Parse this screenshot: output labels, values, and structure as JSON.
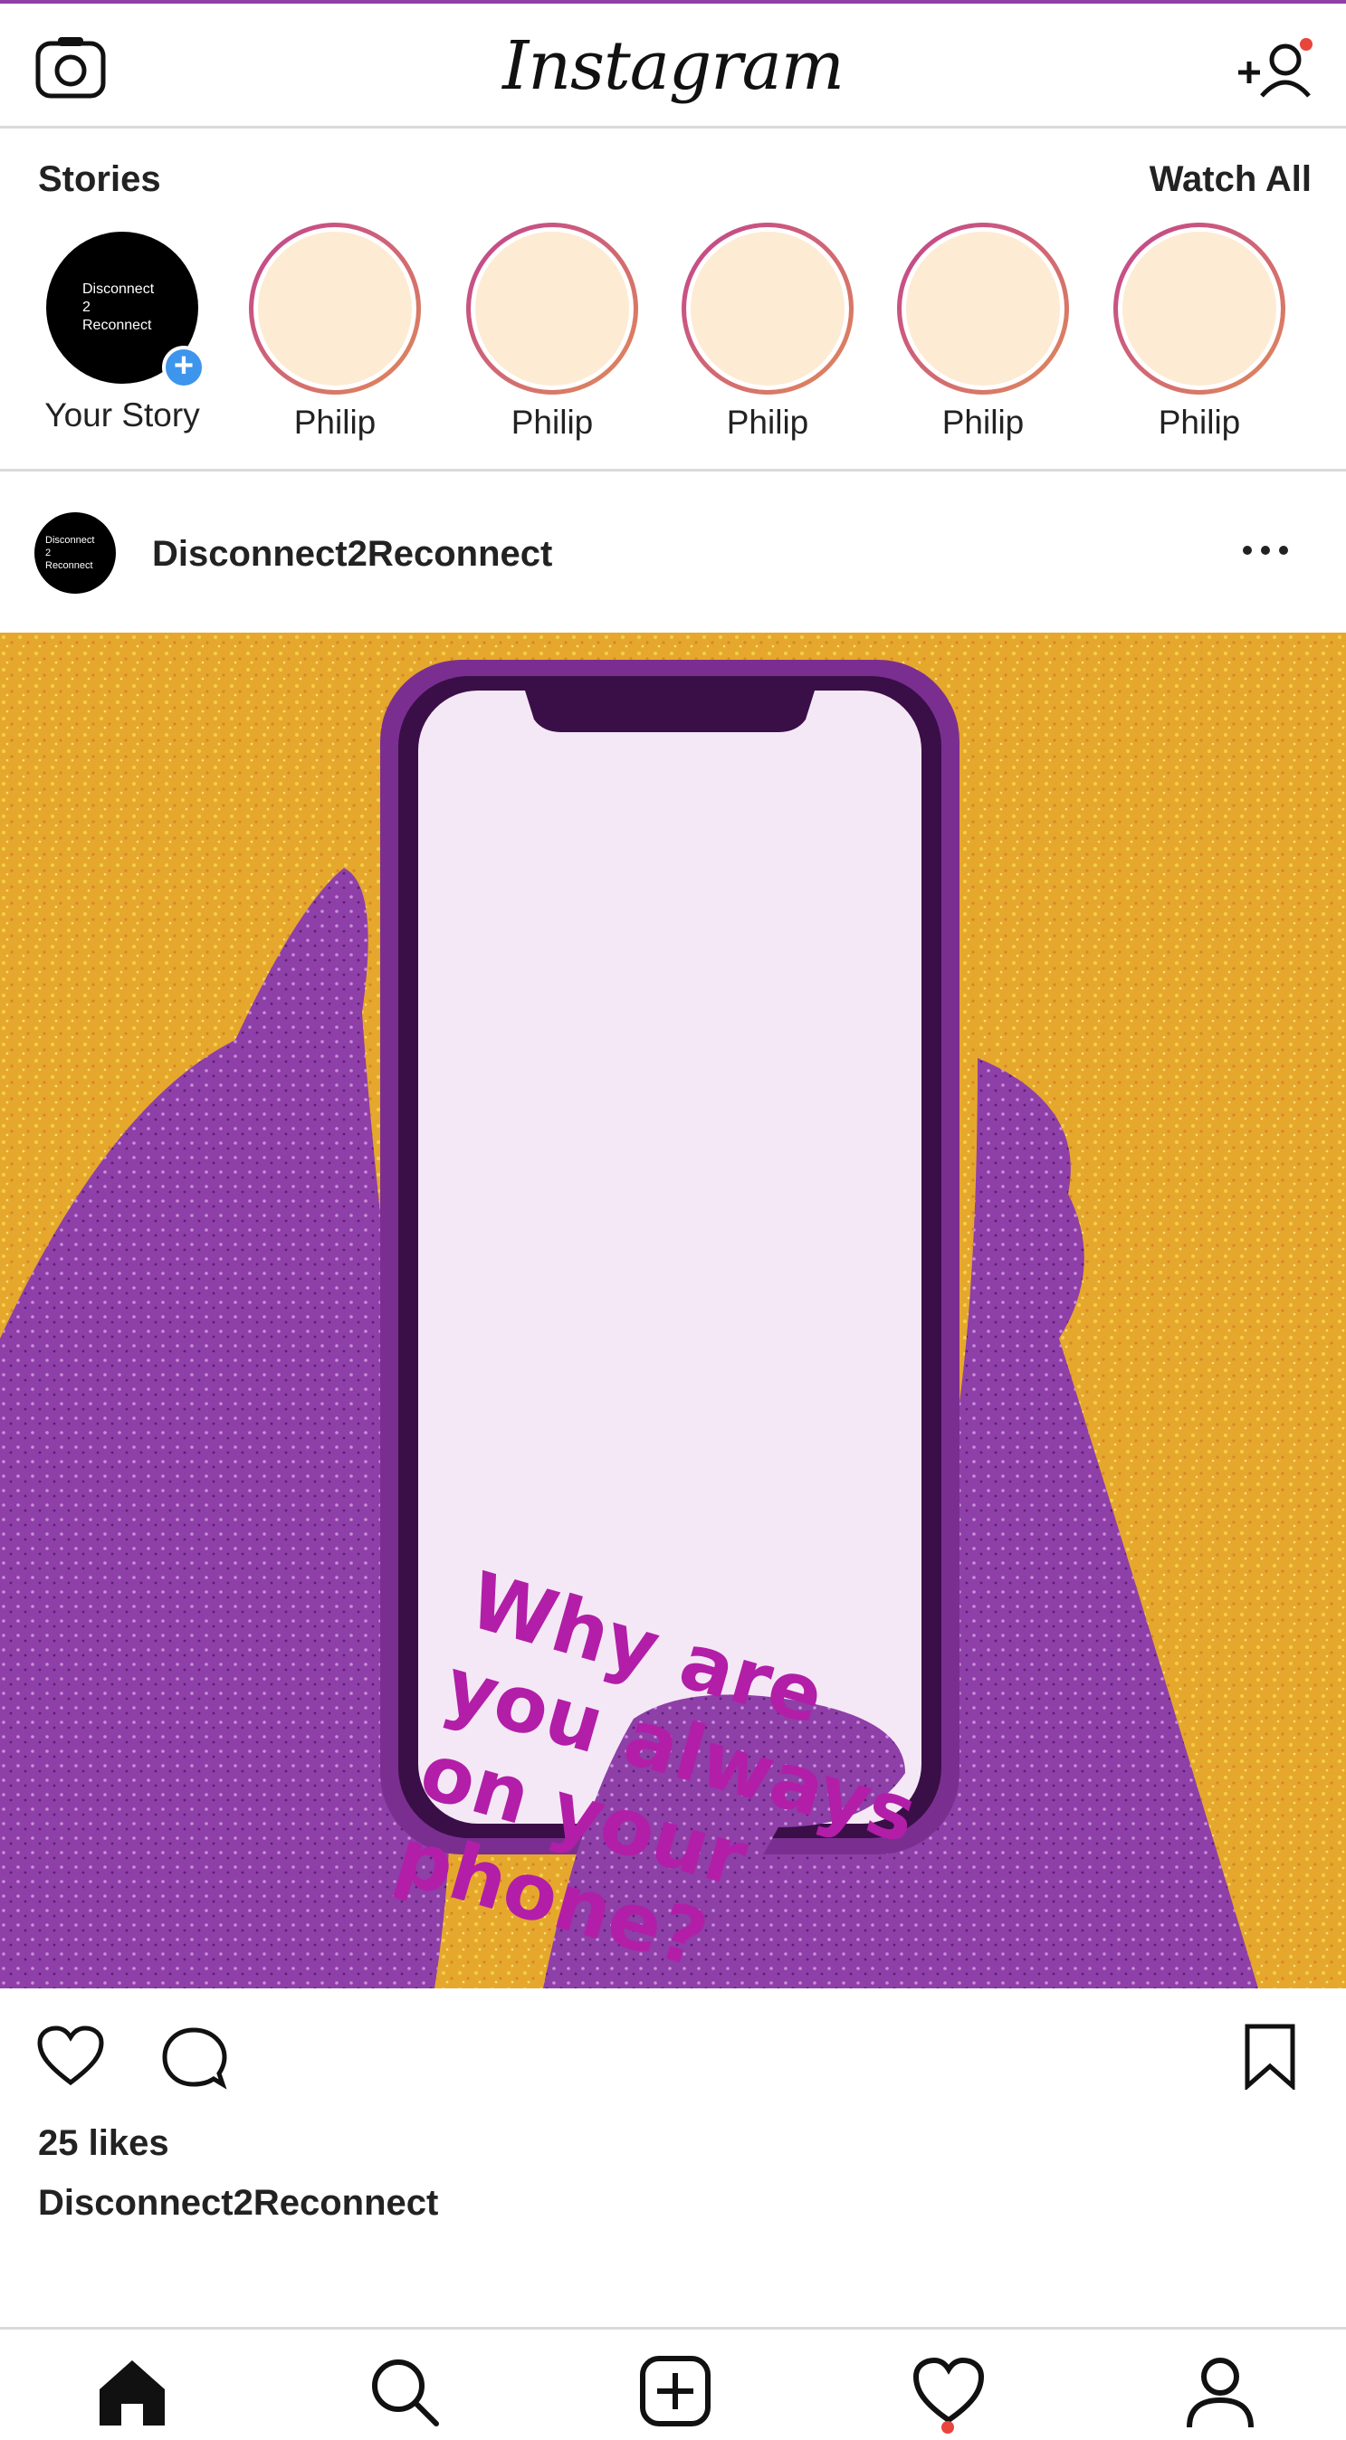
{
  "header": {
    "title": "Instagram",
    "left_icon": "camera-icon",
    "right_icon": "add-user-icon"
  },
  "stories": {
    "title": "Stories",
    "watch_all": "Watch All",
    "your_story": {
      "label": "Your Story",
      "avatar_text": [
        "Disconnect",
        "2",
        "Reconnect"
      ]
    },
    "items": [
      {
        "name": "Philip"
      },
      {
        "name": "Philip"
      },
      {
        "name": "Philip"
      },
      {
        "name": "Philip"
      },
      {
        "name": "Philip"
      }
    ]
  },
  "post": {
    "username": "Disconnect2Reconnect",
    "avatar_text": [
      "Disconnect",
      "2",
      "Reconnect"
    ],
    "image_text": "Why are you always on your phone?",
    "likes": "25 likes",
    "caption_user": "Disconnect2Reconnect"
  },
  "tabbar": {
    "items": [
      "home-icon",
      "search-icon",
      "new-post-icon",
      "activity-heart-icon",
      "profile-icon"
    ]
  },
  "colors": {
    "accent_ring_start": "#c1438e",
    "accent_ring_end": "#e08a5a",
    "add_badge": "#3d95ec",
    "notification": "#e8453c",
    "image_background": "#e6a82c",
    "image_hands": "#8e3fa8",
    "image_text": "#b21ea8"
  }
}
